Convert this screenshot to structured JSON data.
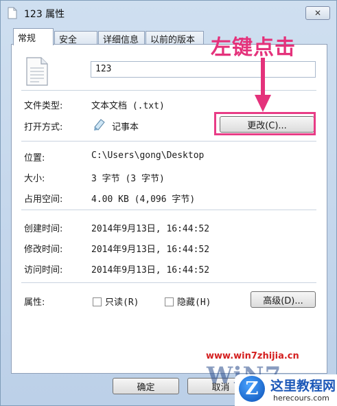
{
  "window": {
    "title": "123 属性",
    "close_glyph": "✕"
  },
  "tabs": [
    {
      "label": "常规",
      "active": true
    },
    {
      "label": "安全",
      "active": false
    },
    {
      "label": "详细信息",
      "active": false
    },
    {
      "label": "以前的版本",
      "active": false
    }
  ],
  "general": {
    "file_name": "123",
    "file_type_label": "文件类型:",
    "file_type_value": "文本文档 (.txt)",
    "open_with_label": "打开方式:",
    "open_with_value": "记事本",
    "change_button": "更改(C)...",
    "location_label": "位置:",
    "location_value": "C:\\Users\\gong\\Desktop",
    "size_label": "大小:",
    "size_value": "3 字节 (3 字节)",
    "size_on_disk_label": "占用空间:",
    "size_on_disk_value": "4.00 KB (4,096 字节)",
    "created_label": "创建时间:",
    "created_value": "2014年9月13日, 16:44:52",
    "modified_label": "修改时间:",
    "modified_value": "2014年9月13日, 16:44:52",
    "accessed_label": "访问时间:",
    "accessed_value": "2014年9月13日, 16:44:52",
    "attributes_label": "属性:",
    "readonly_label": "只读(R)",
    "hidden_label": "隐藏(H)",
    "advanced_button": "高级(D)..."
  },
  "footer": {
    "ok_button": "确定",
    "cancel_button": "取消"
  },
  "annotation": {
    "text": "左键点击",
    "color": "#e4327b"
  },
  "watermark": {
    "url": "www.win7zhijia.cn",
    "logo": "WiN7",
    "badge_name": "这里教程网",
    "badge_domain": "herecours.com",
    "badge_letter": "Z"
  }
}
